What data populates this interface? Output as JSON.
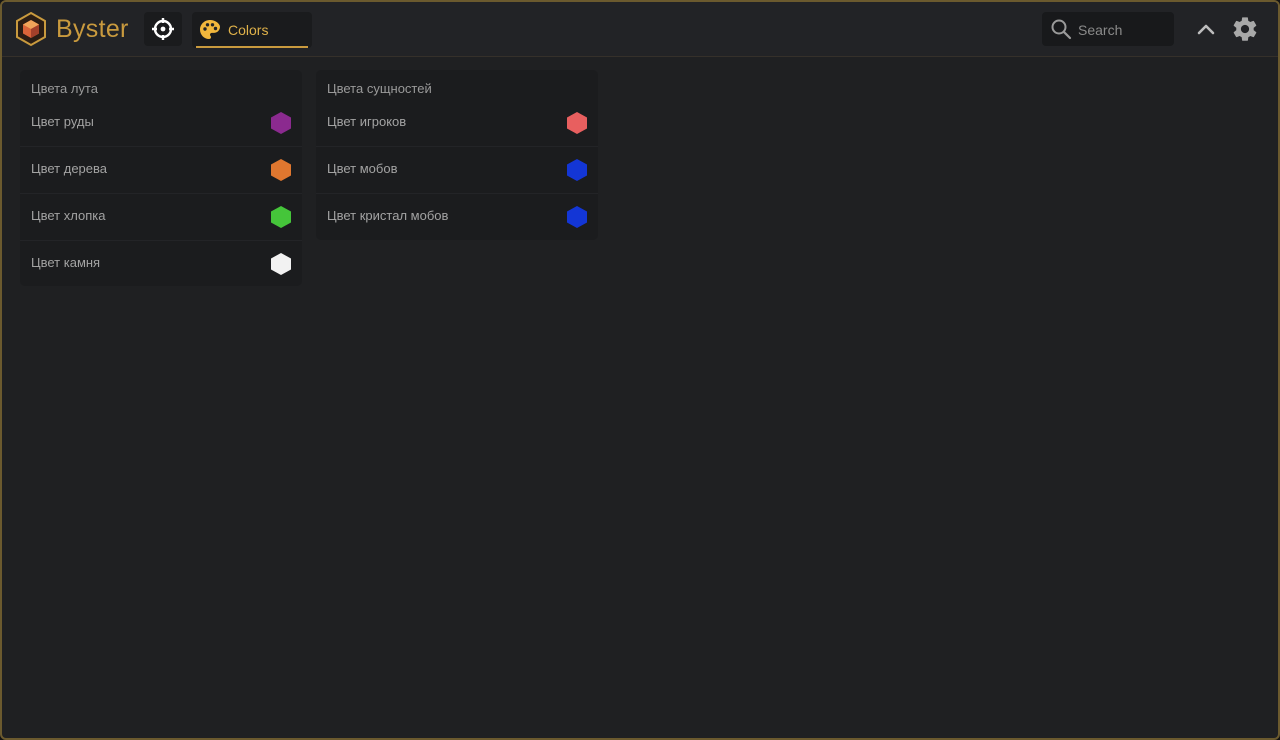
{
  "app": {
    "brand": "Byster"
  },
  "header": {
    "tabs": [
      {
        "label": "Colors",
        "active": true
      }
    ],
    "search": {
      "placeholder": "Search",
      "value": ""
    },
    "accent": "#c99a3e"
  },
  "panels": [
    {
      "title": "Цвета лута",
      "rows": [
        {
          "label": "Цвет руды",
          "color": "#8b2a8f"
        },
        {
          "label": "Цвет дерева",
          "color": "#e0772f"
        },
        {
          "label": "Цвет хлопка",
          "color": "#45c53a"
        },
        {
          "label": "Цвет камня",
          "color": "#f2f2f2"
        }
      ]
    },
    {
      "title": "Цвета сущностей",
      "rows": [
        {
          "label": "Цвет игроков",
          "color": "#e85f5f"
        },
        {
          "label": "Цвет мобов",
          "color": "#1336d6"
        },
        {
          "label": "Цвет кристал мобов",
          "color": "#1336d6"
        }
      ]
    }
  ]
}
